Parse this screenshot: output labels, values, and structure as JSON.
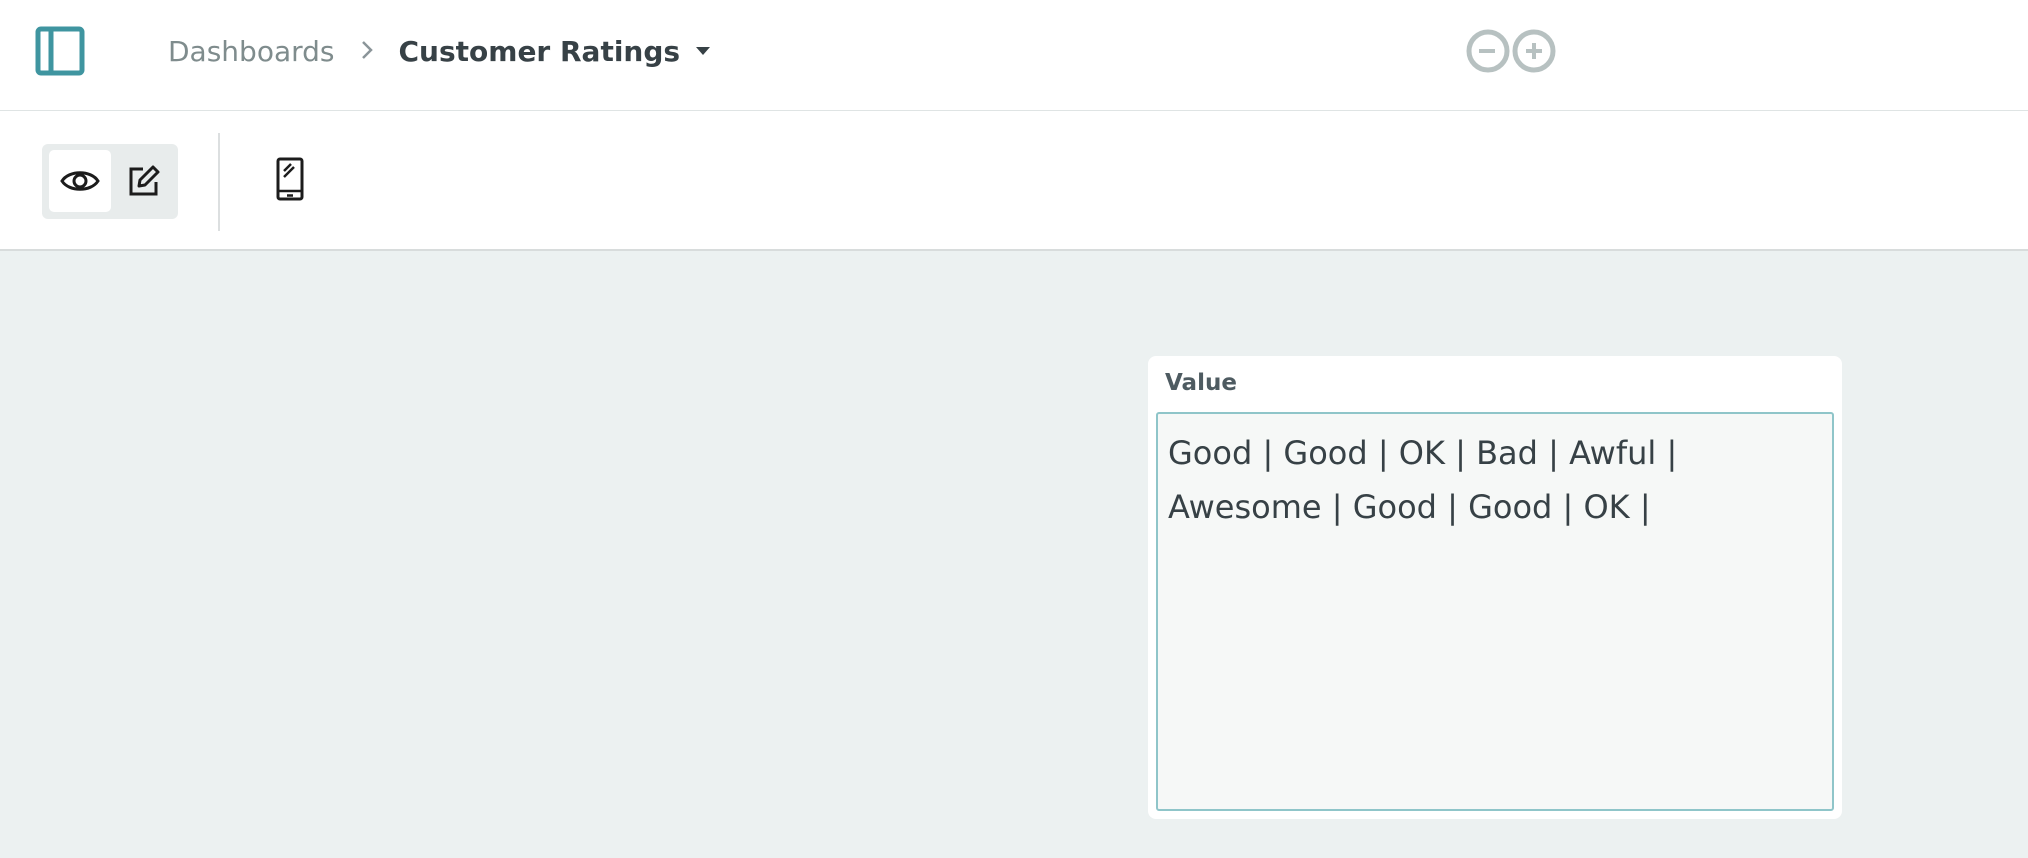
{
  "header": {
    "breadcrumb_root": "Dashboards",
    "breadcrumb_separator": "›",
    "dashboard_title": "Customer Ratings",
    "icons": {
      "sidebar_toggle": "sidebar-panel-icon",
      "dropdown": "caret-down-icon",
      "logo": "infinity-minus-plus-logo"
    }
  },
  "toolbar": {
    "view_mode_icon": "eye-icon",
    "edit_mode_icon": "pencil-edit-icon",
    "mobile_icon": "mobile-phone-icon",
    "active_mode": "view"
  },
  "widget": {
    "title": "Value",
    "value": "Good | Good | OK | Bad | Awful | Awesome | Good | Good | OK |"
  },
  "colors": {
    "accent": "#3f95a0",
    "background": "#ecf1f1",
    "text_dark": "#374146",
    "text_muted": "#7f8c8d",
    "logo_gray": "#b7c1c1"
  }
}
